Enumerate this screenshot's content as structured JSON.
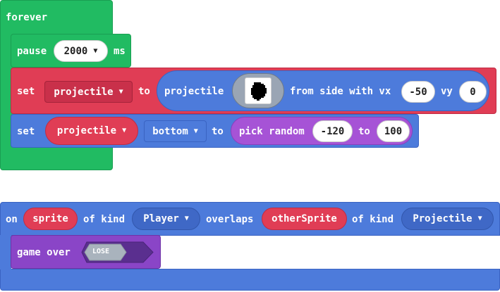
{
  "forever_block": {
    "label": "forever",
    "color": "#21bb62"
  },
  "pause_block": {
    "label": "pause",
    "value": "2000",
    "unit": "ms"
  },
  "set_projectile_block": {
    "label": "set",
    "variable": "projectile",
    "to_label": "to",
    "color": "#e03d55",
    "create": {
      "label": "projectile",
      "image_icon": "sprite-image-icon",
      "from_side_label": "from side with vx",
      "vx": "-50",
      "vy_label": "vy",
      "vy": "0",
      "color": "#4d7bdb"
    }
  },
  "set_bottom_block": {
    "label": "set",
    "variable": "projectile",
    "property": "bottom",
    "to_label": "to",
    "color": "#4d7bdb",
    "random": {
      "label": "pick random",
      "min": "-120",
      "to_label": "to",
      "max": "100",
      "color": "#a653d6"
    }
  },
  "overlap_block": {
    "on_label": "on",
    "sprite": "sprite",
    "of_kind_label": "of kind",
    "kind1": "Player",
    "overlaps_label": "overlaps",
    "other_sprite": "otherSprite",
    "of_kind_label2": "of kind",
    "kind2": "Projectile",
    "color": "#4d7bdb"
  },
  "game_over_block": {
    "label": "game over",
    "result": "LOSE",
    "color": "#8a45c7"
  }
}
